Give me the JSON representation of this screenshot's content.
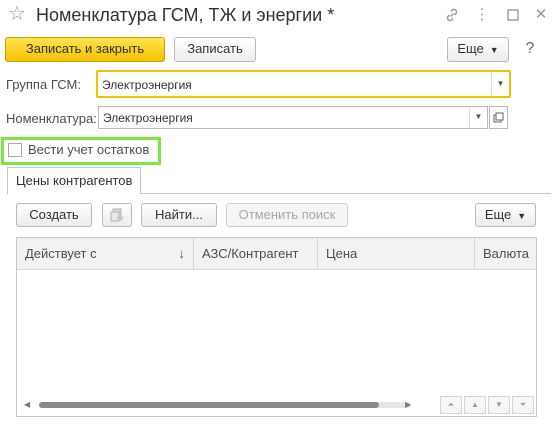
{
  "window": {
    "title": "Номенклатура ГСМ, ТЖ и энергии *",
    "icons": {
      "favorite": "star-icon",
      "link": "link-icon",
      "menu": "more-vertical-icon",
      "maximize": "maximize-icon",
      "close": "close-icon"
    }
  },
  "toolbar": {
    "save_close_label": "Записать и закрыть",
    "save_label": "Записать",
    "more_label": "Еще"
  },
  "form": {
    "group_label": "Группа ГСМ:",
    "group_value": "Электроэнергия",
    "nomenclature_label": "Номенклатура:",
    "nomenclature_value": "Электроэнергия",
    "track_balance_label": "Вести учет остатков",
    "track_balance_checked": false
  },
  "tabs": [
    {
      "label": "Цены контрагентов",
      "active": true
    }
  ],
  "table_toolbar": {
    "create_label": "Создать",
    "find_label": "Найти...",
    "cancel_search_label": "Отменить поиск",
    "more_label": "Еще"
  },
  "table": {
    "columns": [
      "Действует с",
      "АЗС/Контрагент",
      "Цена",
      "Валюта"
    ],
    "sort_indicator": "↓",
    "rows": []
  },
  "colors": {
    "primary_button": "#f5c100",
    "focus_border": "#f2c200",
    "highlight_frame": "#7de640"
  }
}
